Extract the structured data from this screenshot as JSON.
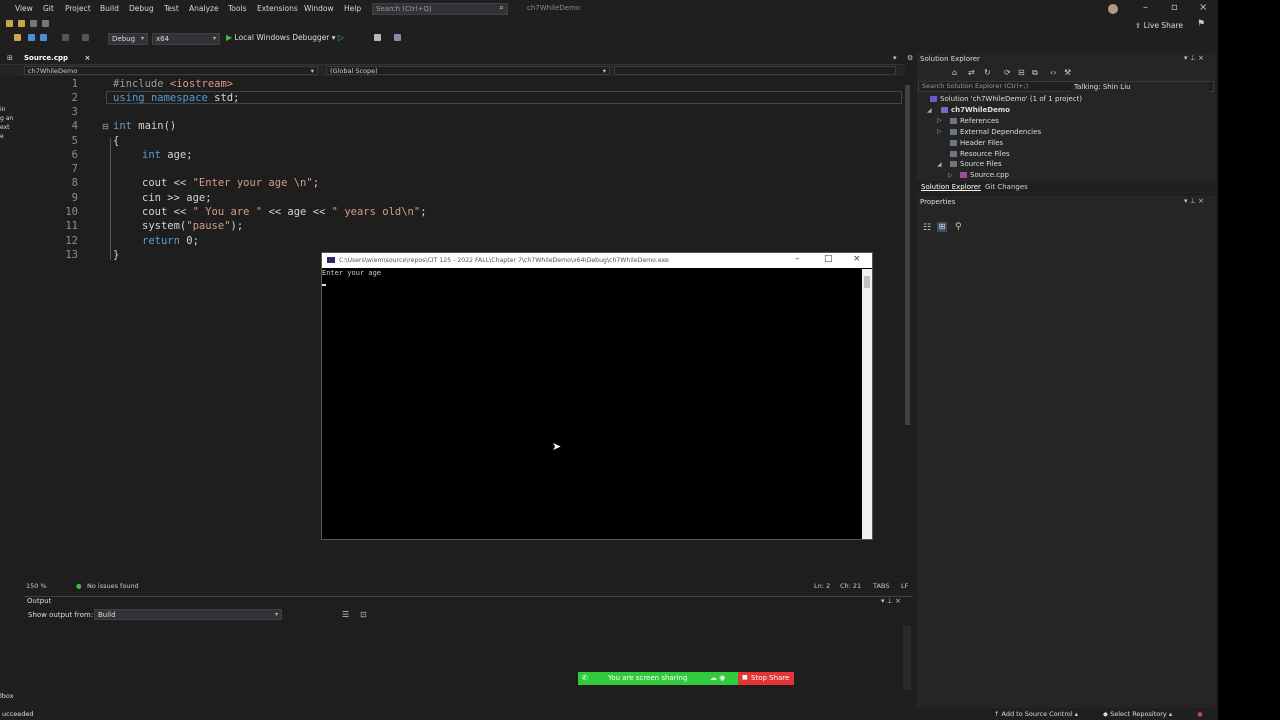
{
  "menu": [
    "View",
    "Git",
    "Project",
    "Build",
    "Debug",
    "Test",
    "Analyze",
    "Tools",
    "Extensions",
    "Window",
    "Help"
  ],
  "search_placeholder": "Search (Ctrl+Q)",
  "solution_name_title": "ch7WhileDemo",
  "live_share": "Live Share",
  "toolbar": {
    "config": "Debug",
    "platform": "x64",
    "run_label": "Local Windows Debugger"
  },
  "editor": {
    "tab_label": "Source.cpp",
    "project_combo": "ch7WhileDemo",
    "scope_combo": "(Global Scope)",
    "lines": [
      "1",
      "2",
      "3",
      "4",
      "5",
      "6",
      "7",
      "8",
      "9",
      "10",
      "11",
      "12",
      "13"
    ],
    "zoom": "150 %",
    "issues": "No issues found",
    "position_ln": "Ln: 2",
    "position_ch": "Ch: 21",
    "tabs_mode": "TABS",
    "line_ending": "LF"
  },
  "output": {
    "title": "Output",
    "show_from_label": "Show output from:",
    "source": "Build"
  },
  "solution_explorer": {
    "title": "Solution Explorer",
    "search_placeholder": "Search Solution Explorer (Ctrl+;)",
    "talking": "Talking: Shin Liu",
    "solution": "Solution 'ch7WhileDemo' (1 of 1 project)",
    "project": "ch7WhileDemo",
    "items": [
      "References",
      "External Dependencies",
      "Header Files",
      "Resource Files",
      "Source Files",
      "Source.cpp"
    ],
    "tab_explorer": "Solution Explorer",
    "tab_git": "Git Changes"
  },
  "properties": {
    "title": "Properties"
  },
  "console": {
    "title": "C:\\Users\\wiem\\source\\repos\\CIT 125 - 2022 FALL\\Chapter 7\\ch7WhileDemo\\x64\\Debug\\ch7WhileDemo.exe",
    "output": "Enter your age"
  },
  "share": {
    "status": "You are screen sharing",
    "stop": "Stop Share"
  },
  "statusbar": {
    "left": "ucceeded",
    "source_control": "Add to Source Control",
    "repository": "Select Repository",
    "toolbox_fragment": "lbox"
  },
  "left_cutoff": [
    "in",
    "g an",
    "ext",
    "e"
  ]
}
